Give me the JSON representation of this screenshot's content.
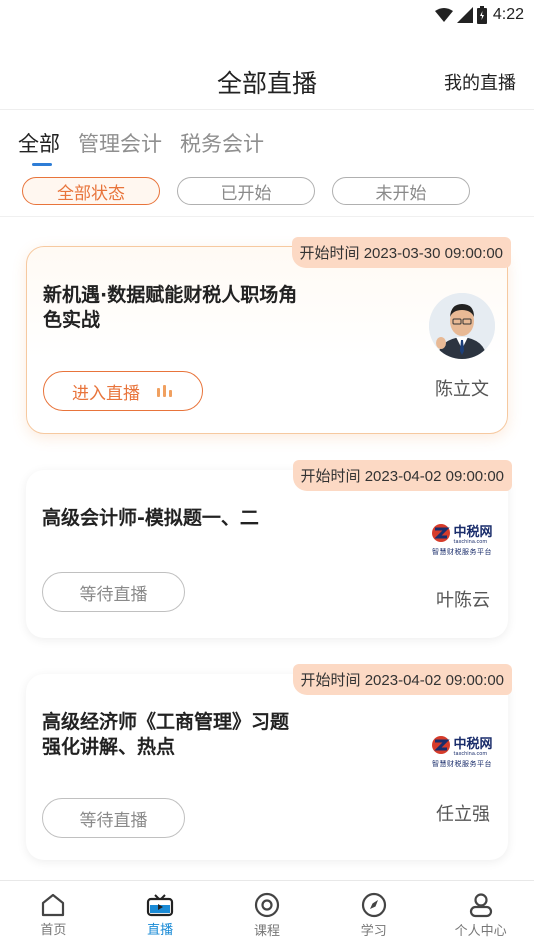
{
  "status_bar": {
    "time": "4:22",
    "icons": [
      "wifi-icon",
      "signal-icon",
      "battery-icon"
    ]
  },
  "header": {
    "title": "全部直播",
    "right_link": "我的直播"
  },
  "category_tabs": [
    {
      "label": "全部",
      "active": true
    },
    {
      "label": "管理会计",
      "active": false
    },
    {
      "label": "税务会计",
      "active": false
    }
  ],
  "status_filters": [
    {
      "label": "全部状态",
      "active": true
    },
    {
      "label": "已开始",
      "active": false
    },
    {
      "label": "未开始",
      "active": false
    }
  ],
  "cards": [
    {
      "start_time": "开始时间 2023-03-30 09:00:00",
      "title": "新机遇·数据赋能财税人职场角色实战",
      "button": "进入直播",
      "teacher": "陈立文",
      "thumb": "avatar"
    },
    {
      "start_time": "开始时间 2023-04-02 09:00:00",
      "title": "高级会计师-模拟题一、二",
      "button": "等待直播",
      "teacher": "叶陈云",
      "thumb": "logo"
    },
    {
      "start_time": "开始时间 2023-04-02 09:00:00",
      "title": "高级经济师《工商管理》习题强化讲解、热点",
      "button": "等待直播",
      "teacher": "任立强",
      "thumb": "logo"
    }
  ],
  "logo": {
    "name": "中税网",
    "domain": "taxchina.com",
    "tagline": "智慧财税服务平台"
  },
  "bottom_nav": [
    {
      "label": "首页",
      "icon": "home-icon",
      "active": false
    },
    {
      "label": "直播",
      "icon": "tv-icon",
      "active": true
    },
    {
      "label": "课程",
      "icon": "course-icon",
      "active": false
    },
    {
      "label": "学习",
      "icon": "compass-icon",
      "active": false
    },
    {
      "label": "个人中心",
      "icon": "user-icon",
      "active": false
    }
  ],
  "colors": {
    "accent": "#e8743b",
    "nav_active": "#1a8bd6",
    "badge_bg": "#fcd9c4",
    "tab_indicator": "#2e7dd6"
  }
}
